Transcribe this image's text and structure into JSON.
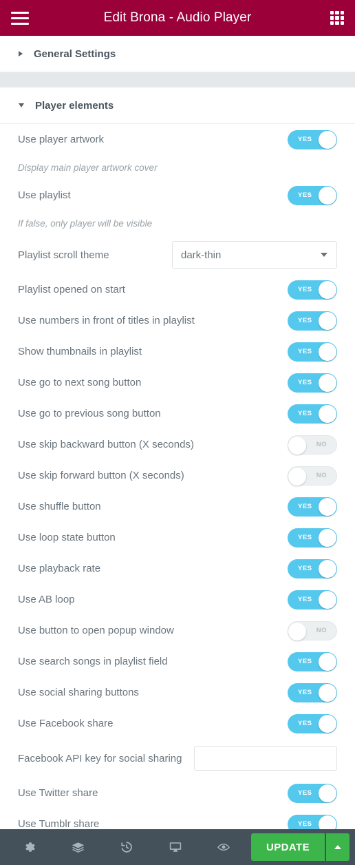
{
  "header": {
    "title": "Edit Brona - Audio Player",
    "menu_icon": "hamburger-icon",
    "apps_icon": "grid-apps-icon"
  },
  "sections": [
    {
      "label": "General Settings",
      "expanded": false
    },
    {
      "label": "Player elements",
      "expanded": true
    }
  ],
  "toggle_labels": {
    "on": "YES",
    "off": "NO"
  },
  "rows": [
    {
      "type": "toggle",
      "label": "Use player artwork",
      "value": "YES"
    },
    {
      "type": "hint",
      "label": "Display main player artwork cover"
    },
    {
      "type": "toggle",
      "label": "Use playlist",
      "value": "YES"
    },
    {
      "type": "hint",
      "label": "If false, only player will be visible"
    },
    {
      "type": "select",
      "label": "Playlist scroll theme",
      "value": "dark-thin"
    },
    {
      "type": "toggle",
      "label": "Playlist opened on start",
      "value": "YES"
    },
    {
      "type": "toggle",
      "label": "Use numbers in front of titles in playlist",
      "value": "YES"
    },
    {
      "type": "toggle",
      "label": "Show thumbnails in playlist",
      "value": "YES"
    },
    {
      "type": "toggle",
      "label": "Use go to next song button",
      "value": "YES"
    },
    {
      "type": "toggle",
      "label": "Use go to previous song button",
      "value": "YES"
    },
    {
      "type": "toggle",
      "label": "Use skip backward button (X seconds)",
      "value": "NO"
    },
    {
      "type": "toggle",
      "label": "Use skip forward button (X seconds)",
      "value": "NO"
    },
    {
      "type": "toggle",
      "label": "Use shuffle button",
      "value": "YES"
    },
    {
      "type": "toggle",
      "label": "Use loop state button",
      "value": "YES"
    },
    {
      "type": "toggle",
      "label": "Use playback rate",
      "value": "YES"
    },
    {
      "type": "toggle",
      "label": "Use AB loop",
      "value": "YES"
    },
    {
      "type": "toggle",
      "label": "Use button to open popup window",
      "value": "NO"
    },
    {
      "type": "toggle",
      "label": "Use search songs in playlist field",
      "value": "YES"
    },
    {
      "type": "toggle",
      "label": "Use social sharing buttons",
      "value": "YES"
    },
    {
      "type": "toggle",
      "label": "Use Facebook share",
      "value": "YES"
    },
    {
      "type": "input",
      "label": "Facebook API key for social sharing",
      "value": "",
      "placeholder": ""
    },
    {
      "type": "toggle",
      "label": "Use Twitter share",
      "value": "YES"
    },
    {
      "type": "toggle",
      "label": "Use Tumblr share",
      "value": "YES"
    }
  ],
  "toolbar": {
    "icons": [
      "gear-icon",
      "layers-icon",
      "history-icon",
      "desktop-icon",
      "eye-icon"
    ],
    "update_label": "UPDATE",
    "caret_icon": "chevron-up-icon"
  },
  "colors": {
    "header": "#9b0039",
    "toggle_on": "#55c8ee",
    "toggle_off": "#edf0f1",
    "update": "#3cb54a",
    "toolbar": "#45515a",
    "divider_band": "#e4e8ea"
  }
}
